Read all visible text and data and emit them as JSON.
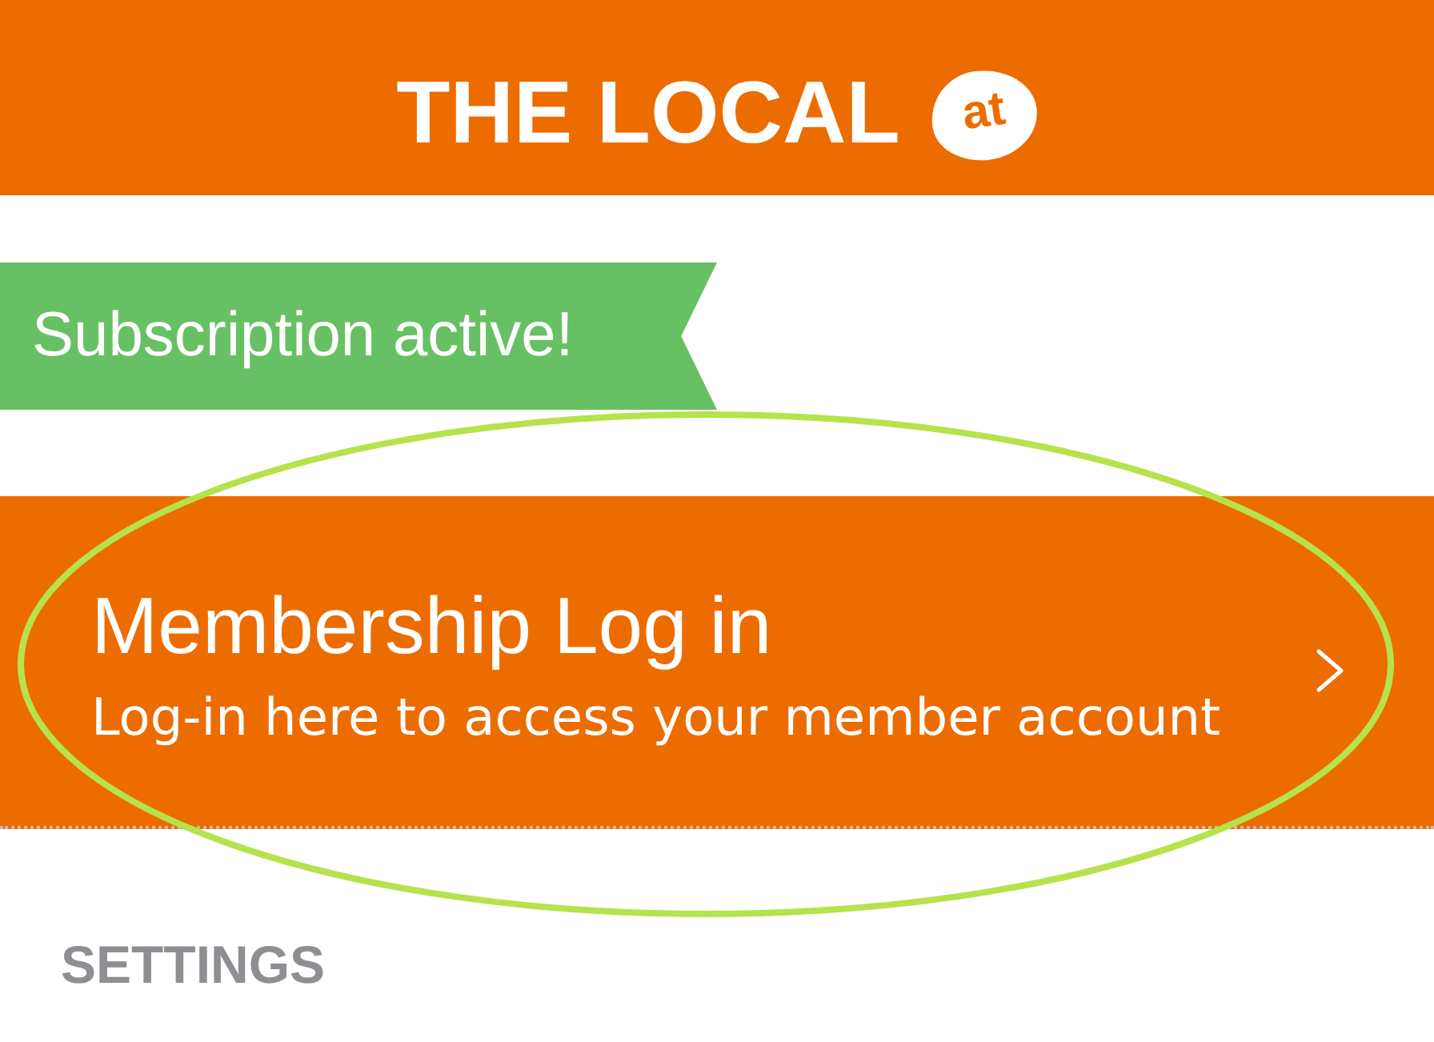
{
  "header": {
    "logo_text": "THE LOCAL",
    "logo_badge": "at"
  },
  "status_banner": {
    "text": "Subscription active!"
  },
  "menu_rows": [
    {
      "title": "Membership Log in",
      "subtitle": "Log-in here to access your member account"
    }
  ],
  "sections": [
    {
      "title": "SETTINGS"
    }
  ],
  "annotations": [
    {
      "kind": "ellipse"
    }
  ]
}
